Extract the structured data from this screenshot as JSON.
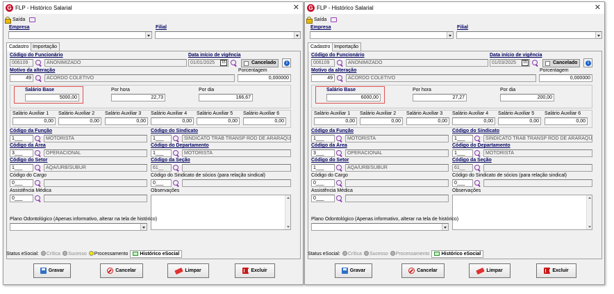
{
  "app_logo_letter": "G",
  "icons": {
    "close": "close-icon",
    "exit": "lock-icon",
    "monitor": "monitor-icon",
    "search": "search-icon",
    "calendar": "calendar-icon",
    "info": "info-icon",
    "save": "save-icon",
    "cancel": "cancel-icon",
    "clear": "eraser-icon",
    "delete": "trash-icon"
  },
  "colors": {
    "label_blue": "#000060",
    "highlight_red": "#e05050",
    "search_purple": "#8a3bb0"
  },
  "windows": [
    {
      "title": "FLP - Histórico Salarial",
      "toolbar": {
        "exit_label": "Saída"
      },
      "empresa": {
        "label": "Empresa",
        "value": ""
      },
      "filial": {
        "label": "Filial",
        "value": ""
      },
      "tabs": [
        {
          "label": "Cadastro",
          "active": true
        },
        {
          "label": "Importação",
          "active": false
        }
      ],
      "funcionario": {
        "label": "Código do Funcionário",
        "code": "006109",
        "name": "ANONIMIZADO"
      },
      "vigencia": {
        "label": "Data início de vigência",
        "date": "01/01/2025",
        "calendar_text": "15"
      },
      "cancelado": {
        "label": "Cancelado",
        "checked": false
      },
      "motivo": {
        "label": "Motivo da alteração",
        "code": "49",
        "description": "ACORDO COLETIVO"
      },
      "porcentagem": {
        "label": "Porcentagem",
        "value": "0,000000"
      },
      "salario_base": {
        "label": "Salário Base",
        "value": "5000,00"
      },
      "por_hora": {
        "label": "Por hora",
        "value": "22,73"
      },
      "por_dia": {
        "label": "Por dia",
        "value": "166,67"
      },
      "auxiliares": [
        {
          "label": "Salário Auxiliar 1",
          "value": "0,00"
        },
        {
          "label": "Salário Auxiliar 2",
          "value": "0,00"
        },
        {
          "label": "Salário Auxiliar 3",
          "value": "0,00"
        },
        {
          "label": "Salário Auxiliar 4",
          "value": "0,00"
        },
        {
          "label": "Salário Auxiliar 5",
          "value": "0,00"
        },
        {
          "label": "Salário Auxiliar 6",
          "value": "0,00"
        }
      ],
      "funcao": {
        "label": "Código da Função",
        "code": "1___",
        "name": "MOTORISTA"
      },
      "sindicato": {
        "label": "Código do Sindicato",
        "code": "1___",
        "name": "SINDICATO TRAB TRANSP ROD DE ARARAQU"
      },
      "area": {
        "label": "Código da Área",
        "code": "3___",
        "name": "OPERACIONAL"
      },
      "departamento": {
        "label": "Código do Departamento",
        "code": "1___",
        "name": "MOTORISTA"
      },
      "setor": {
        "label": "Código do Setor",
        "code": "1___",
        "name": "AQA/URB/SUBUR"
      },
      "secao": {
        "label": "Código da Seção",
        "code": "61__",
        "name": ""
      },
      "cargo": {
        "label": "Código do Cargo",
        "code": "0___",
        "name": ""
      },
      "sindicato_socios": {
        "label": "Código do Sindicato de sócios (para relação sindical)",
        "code": "0___",
        "name": ""
      },
      "assistencia": {
        "label": "Assistência Médica",
        "code": "0___",
        "name": ""
      },
      "observacoes": {
        "label": "Observações",
        "value": ""
      },
      "plano_odonto": {
        "label": "Plano Odontológico (Apenas informativo, alterar na tela de histórico)",
        "value": ""
      },
      "status": {
        "label": "Status eSocial:",
        "items": [
          {
            "label": "Crítica",
            "color": "#b0b0b0",
            "enabled": false
          },
          {
            "label": "Sucesso",
            "color": "#b0b0b0",
            "enabled": false
          },
          {
            "label": "Processamento",
            "color": "#f2e600",
            "enabled": true
          }
        ],
        "history_tab": "Histórico eSocial"
      },
      "buttons": {
        "save": "Gravar",
        "cancel": "Cancelar",
        "clear": "Limpar",
        "delete": "Excluir"
      }
    },
    {
      "title": "FLP - Histórico Salarial",
      "toolbar": {
        "exit_label": "Saída"
      },
      "empresa": {
        "label": "Empresa",
        "value": ""
      },
      "filial": {
        "label": "Filial",
        "value": ""
      },
      "tabs": [
        {
          "label": "Cadastro",
          "active": true
        },
        {
          "label": "Importação",
          "active": false
        }
      ],
      "funcionario": {
        "label": "Código do Funcionário",
        "code": "006109",
        "name": "ANONIMIZADO"
      },
      "vigencia": {
        "label": "Data início de vigência",
        "date": "01/03/2025",
        "calendar_text": "15"
      },
      "cancelado": {
        "label": "Cancelado",
        "checked": false
      },
      "motivo": {
        "label": "Motivo da alteração",
        "code": "49",
        "description": "ACORDO COLETIVO"
      },
      "porcentagem": {
        "label": "Porcentagem",
        "value": "0,000000"
      },
      "salario_base": {
        "label": "Salário Base",
        "value": "6000,00"
      },
      "por_hora": {
        "label": "Por hora",
        "value": "27,27"
      },
      "por_dia": {
        "label": "Por dia",
        "value": "200,00"
      },
      "auxiliares": [
        {
          "label": "Salário Auxiliar 1",
          "value": "0,00"
        },
        {
          "label": "Salário Auxiliar 2",
          "value": "0,00"
        },
        {
          "label": "Salário Auxiliar 3",
          "value": "0,00"
        },
        {
          "label": "Salário Auxiliar 4",
          "value": "0,00"
        },
        {
          "label": "Salário Auxiliar 5",
          "value": "0,00"
        },
        {
          "label": "Salário Auxiliar 6",
          "value": "0,00"
        }
      ],
      "funcao": {
        "label": "Código da Função",
        "code": "1___",
        "name": "MOTORISTA"
      },
      "sindicato": {
        "label": "Código do Sindicato",
        "code": "1___",
        "name": "SINDICATO TRAB TRANSP ROD DE ARARAQU"
      },
      "area": {
        "label": "Código da Área",
        "code": "3___",
        "name": "OPERACIONAL"
      },
      "departamento": {
        "label": "Código do Departamento",
        "code": "1___",
        "name": "MOTORISTA"
      },
      "setor": {
        "label": "Código do Setor",
        "code": "1___",
        "name": "AQA/URB/SUBUR"
      },
      "secao": {
        "label": "Código da Seção",
        "code": "61__",
        "name": ""
      },
      "cargo": {
        "label": "Código do Cargo",
        "code": "0___",
        "name": ""
      },
      "sindicato_socios": {
        "label": "Código do Sindicato de sócios (para relação sindical)",
        "code": "0___",
        "name": ""
      },
      "assistencia": {
        "label": "Assistência Médica",
        "code": "0___",
        "name": ""
      },
      "observacoes": {
        "label": "Observações",
        "value": ""
      },
      "plano_odonto": {
        "label": "Plano Odontológico (Apenas informativo, alterar na tela de histórico)",
        "value": ""
      },
      "status": {
        "label": "Status eSocial:",
        "items": [
          {
            "label": "Crítica",
            "color": "#b0b0b0",
            "enabled": false
          },
          {
            "label": "Sucesso",
            "color": "#b0b0b0",
            "enabled": false
          },
          {
            "label": "Processamento",
            "color": "#b0b0b0",
            "enabled": false
          }
        ],
        "history_tab": "Histórico eSocial"
      },
      "buttons": {
        "save": "Gravar",
        "cancel": "Cancelar",
        "clear": "Limpar",
        "delete": "Excluir"
      }
    }
  ]
}
